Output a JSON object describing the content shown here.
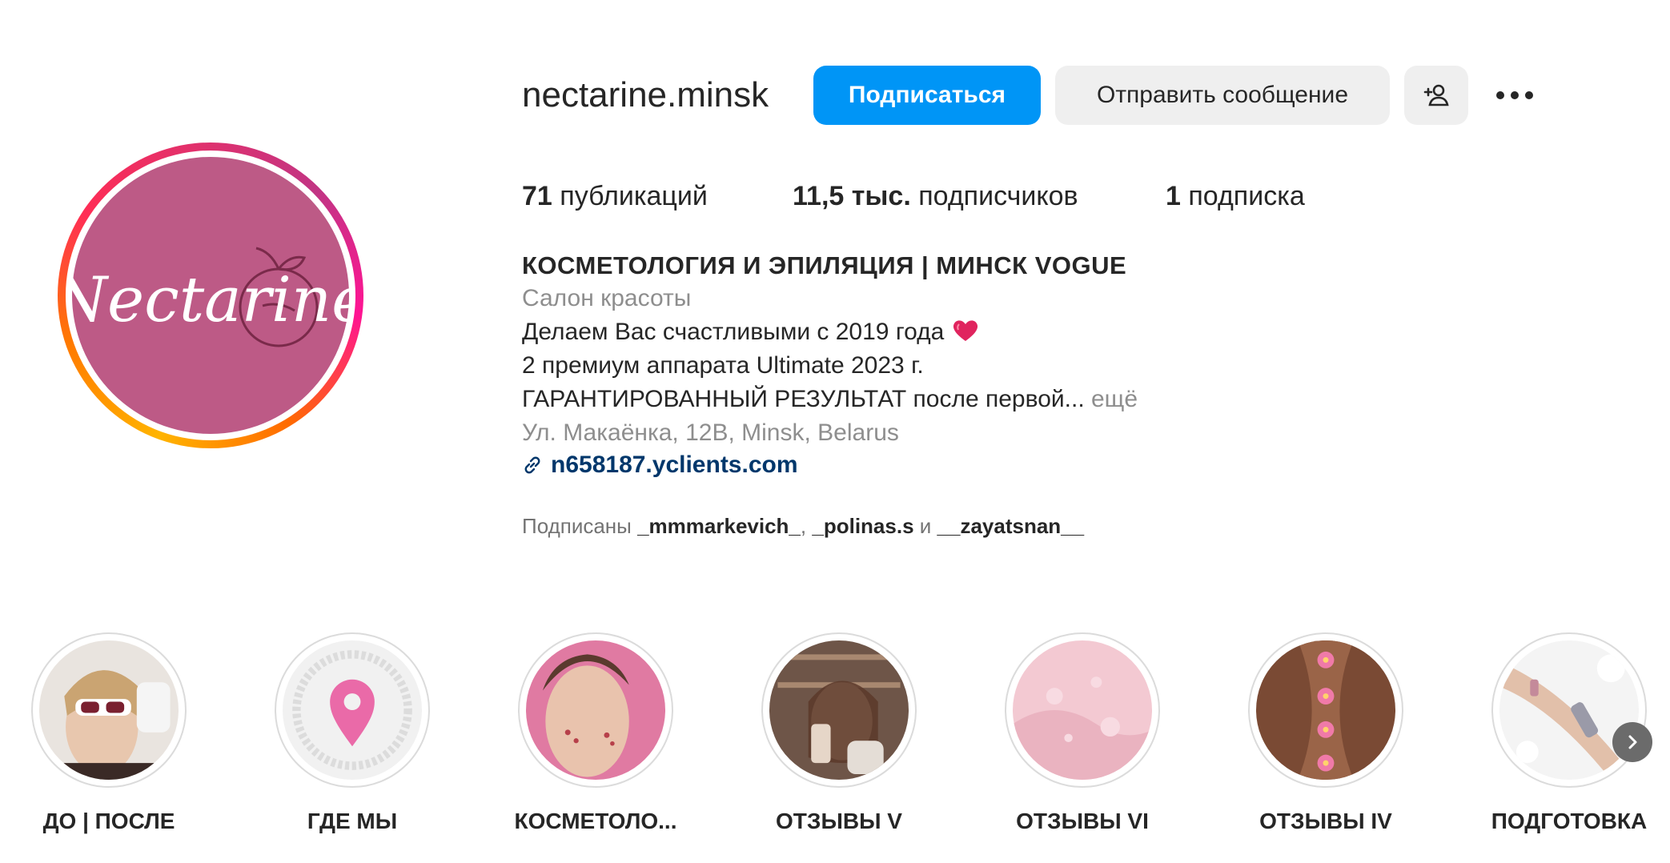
{
  "profile": {
    "username": "nectarine.minsk",
    "avatar_text": "Nectarine",
    "follow_label": "Подписаться",
    "message_label": "Отправить сообщение",
    "add_user_icon": "person-add-icon",
    "more_icon": "more-dots-icon"
  },
  "stats": {
    "posts_count": "71",
    "posts_label": "публикаций",
    "followers_count": "11,5 тыс.",
    "followers_label": "подписчиков",
    "following_count": "1",
    "following_label": "подписка"
  },
  "bio": {
    "full_name": "КОСМЕТОЛОГИЯ И ЭПИЛЯЦИЯ | МИНСК VOGUE",
    "category": "Салон красоты",
    "line1": "Делаем Вас счастливыми с 2019 года",
    "line2": "2 премиум аппарата Ultimate 2023 г.",
    "line3": "ГАРАНТИРОВАННЫЙ РЕЗУЛЬТАТ после первой...",
    "more_label": "ещё",
    "address": "Ул. Макаёнка, 12В, Minsk, Belarus",
    "link": "n658187.yclients.com",
    "followed_prefix": "Подписаны",
    "followed_user1": "_mmmarkevich_",
    "followed_sep": ",",
    "followed_user2": "_polinas.s",
    "followed_and": "и",
    "followed_user3": "__zayatsnan__"
  },
  "highlights": [
    {
      "label": "ДО | ПОСЛЕ"
    },
    {
      "label": "ГДЕ МЫ"
    },
    {
      "label": "КОСМЕТОЛО..."
    },
    {
      "label": "ОТЗЫВЫ V"
    },
    {
      "label": "ОТЗЫВЫ VI"
    },
    {
      "label": "ОТЗЫВЫ IV"
    },
    {
      "label": "ПОДГОТОВКА"
    }
  ],
  "colors": {
    "follow_button": "#0095f6",
    "avatar_bg": "#bd5a86",
    "secondary_button": "#efefef",
    "link": "#00376b"
  }
}
